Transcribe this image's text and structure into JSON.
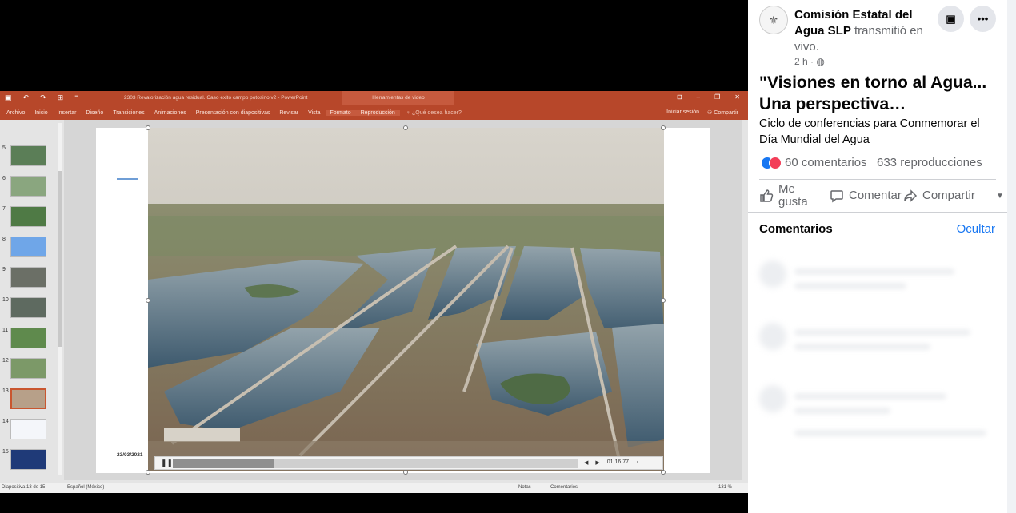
{
  "powerpoint": {
    "document_title": "2303 Revalorización agua residual. Caso exito campo potosino v2 - PowerPoint",
    "video_tools_tab": "Herramientas de video",
    "ribbon_tabs": [
      "Archivo",
      "Inicio",
      "Insertar",
      "Diseño",
      "Transiciones",
      "Animaciones",
      "Presentación con diapositivas",
      "Revisar",
      "Vista",
      "Formato",
      "Reproducción"
    ],
    "tell_me": "¿Qué desea hacer?",
    "sign_in": "Iniciar sesión",
    "share": "Compartir",
    "thumbnails": [
      "5",
      "6",
      "7",
      "8",
      "9",
      "10",
      "11",
      "12",
      "13",
      "14",
      "15"
    ],
    "active_slide": "13",
    "slide_date": "23/03/2021",
    "video_time": "01:16.77",
    "video_progress": 0.25,
    "status_slide": "Diapositiva 13 de 15",
    "status_lang": "Español (México)",
    "status_notes": "Notas",
    "status_comments": "Comentarios",
    "zoom": "131 %"
  },
  "post": {
    "author": "Comisión Estatal del Agua SLP",
    "verb": "transmitió en vivo.",
    "time": "2 h ·",
    "title": "\"Visiones en torno al Agua... Una perspectiva…",
    "description": "Ciclo de conferencias para Conmemorar el Día Mundial del Agua",
    "comments_count": "60 comentarios",
    "views": "633 reproducciones",
    "actions": {
      "like": "Me gusta",
      "comment": "Comentar",
      "share": "Compartir"
    },
    "comments_header": "Comentarios",
    "hide": "Ocultar"
  },
  "colors": {
    "ppt_accent": "#b7472a",
    "fb_blue": "#1877f2",
    "text_secondary": "#65676b"
  }
}
